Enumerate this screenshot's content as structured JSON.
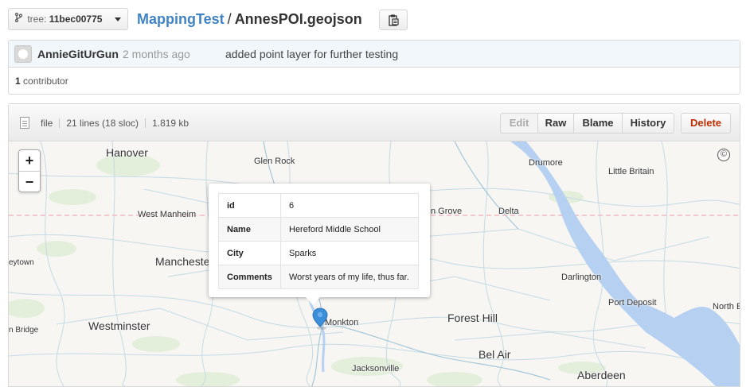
{
  "header": {
    "tree_label": "tree:",
    "tree_name": "11bec00775",
    "repo": "MappingTest",
    "separator": "/",
    "file_name": "AnnesPOI.geojson"
  },
  "commit": {
    "author": "AnnieGitUrGun",
    "time": "2 months ago",
    "message": "added point layer for further testing",
    "contributor_count": "1",
    "contributor_label": "contributor"
  },
  "file": {
    "mode": "file",
    "lines": "21 lines (18 sloc)",
    "size": "1.819 kb",
    "buttons": {
      "edit": "Edit",
      "raw": "Raw",
      "blame": "Blame",
      "history": "History",
      "delete": "Delete"
    }
  },
  "map": {
    "zoom_in": "+",
    "zoom_out": "−",
    "attribution": "©",
    "places": {
      "hanover": "Hanover",
      "glen_rock": "Glen Rock",
      "drumore": "Drumore",
      "little_britain": "Little Britain",
      "west_manheim": "West Manheim",
      "grove": "n Grove",
      "delta": "Delta",
      "taneytown": "eytown",
      "manchester": "Mancheste",
      "darlington": "Darlington",
      "port_deposit": "Port Deposit",
      "north_east": "North E",
      "union_bridge": "n Bridge",
      "westminster": "Westminster",
      "monkton": "Monkton",
      "forest_hill": "Forest Hill",
      "bel_air": "Bel Air",
      "jacksonville": "Jacksonville",
      "aberdeen": "Aberdeen"
    },
    "popup": {
      "rows": [
        {
          "key": "id",
          "value": "6"
        },
        {
          "key": "Name",
          "value": "Hereford Middle School"
        },
        {
          "key": "City",
          "value": "Sparks"
        },
        {
          "key": "Comments",
          "value": "Worst years of my life, thus far."
        }
      ]
    },
    "colors": {
      "water": "#b5d0f0",
      "roads": "#c4dbe4",
      "state_line": "#f2b9c2",
      "marker": "#3b8ed8"
    }
  }
}
